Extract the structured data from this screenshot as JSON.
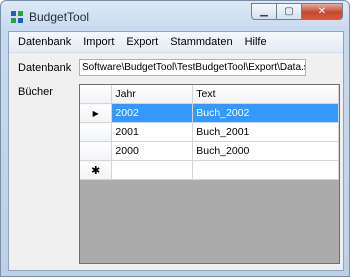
{
  "window": {
    "title": "BudgetTool"
  },
  "menu": [
    "Datenbank",
    "Import",
    "Export",
    "Stammdaten",
    "Hilfe"
  ],
  "form": {
    "database_label": "Datenbank",
    "database_path": "Software\\BudgetTool\\TestBudgetTool\\Export\\Data.sdf",
    "books_label": "Bücher"
  },
  "grid": {
    "columns": [
      "Jahr",
      "Text"
    ],
    "rows": [
      {
        "jahr": "2002",
        "text": "Buch_2002",
        "selected": true
      },
      {
        "jahr": "2001",
        "text": "Buch_2001",
        "selected": false
      },
      {
        "jahr": "2000",
        "text": "Buch_2000",
        "selected": false
      }
    ],
    "current_row_marker": "▶",
    "new_row_marker": "✱"
  },
  "colors": {
    "selection": "#3399ff",
    "icon_blue": "#1f5fbf",
    "icon_green": "#2e9e3e"
  }
}
